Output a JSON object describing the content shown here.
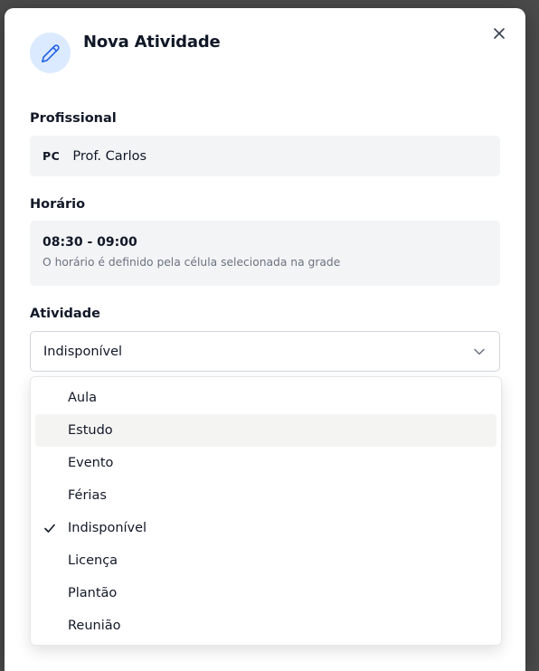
{
  "modal": {
    "title": "Nova Atividade",
    "header_icon": "pencil-icon",
    "close_icon": "close-icon"
  },
  "profissional": {
    "label": "Profissional",
    "initials": "PC",
    "name": "Prof. Carlos"
  },
  "horario": {
    "label": "Horário",
    "range": "08:30 - 09:00",
    "hint": "O horário é definido pela célula selecionada na grade"
  },
  "atividade": {
    "label": "Atividade",
    "selected": "Indisponível",
    "options": [
      {
        "label": "Aula"
      },
      {
        "label": "Estudo"
      },
      {
        "label": "Evento"
      },
      {
        "label": "Férias"
      },
      {
        "label": "Indisponível"
      },
      {
        "label": "Licença"
      },
      {
        "label": "Plantão"
      },
      {
        "label": "Reunião"
      }
    ],
    "highlighted_index": 1,
    "selected_index": 4
  },
  "colors": {
    "accent": "#2563eb",
    "icon_bg": "#dbeafe",
    "readonly_bg": "#f3f4f6",
    "option_hover_bg": "#f4f4f2"
  }
}
